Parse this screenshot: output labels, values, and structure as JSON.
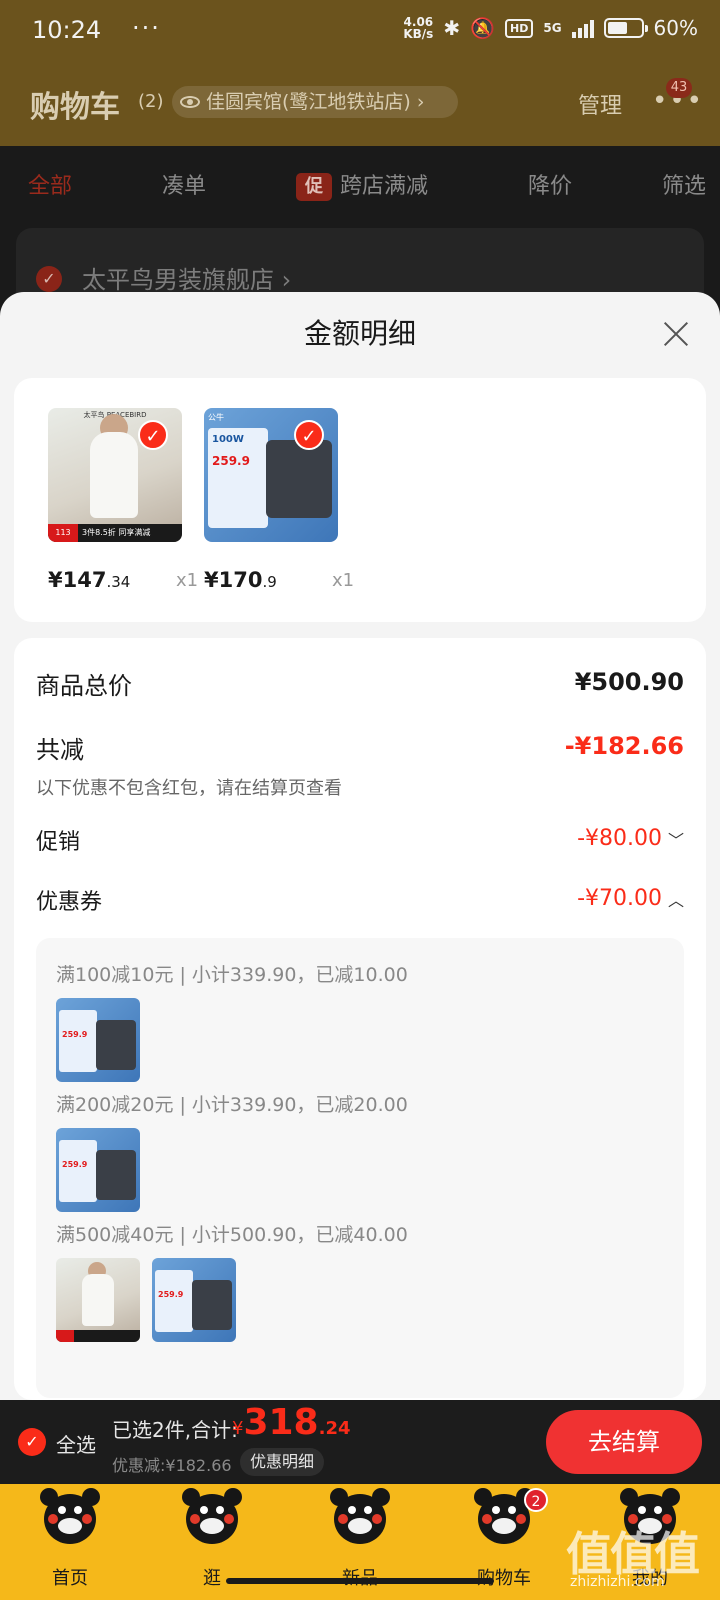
{
  "status_bar": {
    "time": "10:24",
    "dots": "···",
    "net_speed_value": "4.06",
    "net_speed_unit": "KB/s",
    "hd": "HD",
    "network": "5G",
    "battery_percent": "60%",
    "battery_level": 0.6
  },
  "background": {
    "cart_title": "购物车",
    "cart_count": "(2)",
    "store_chip": "佳圆宾馆(鹭江地铁站店)",
    "manage": "管理",
    "more_badge": "43",
    "tabs": [
      "全部",
      "凑单",
      "跨店满减",
      "降价",
      "筛选"
    ],
    "promo_badge": "促",
    "store_name": "太平鸟男装旗舰店",
    "store_chevron": "›"
  },
  "sheet": {
    "title": "金额明细",
    "items": [
      {
        "name": "apparel",
        "price_main": "¥147",
        "price_decimal": ".34",
        "qty": "x1",
        "brand": "太平鸟 PEACEBIRD",
        "tag_price": "113",
        "tag_text": "3件8.5折 同享满减"
      },
      {
        "name": "power-strip",
        "price_main": "¥170",
        "price_decimal": ".9",
        "qty": "x1",
        "brand": "公牛",
        "watt": "100W",
        "panel_price": "259.9"
      }
    ],
    "summary": {
      "total_label": "商品总价",
      "total_value": "¥500.90",
      "reduce_label": "共减",
      "reduce_value": "-¥182.66",
      "hint": "以下优惠不包含红包，请在结算页查看",
      "promo_label": "促销",
      "promo_value": "-¥80.00",
      "promo_chevron": "﹀",
      "coupon_label": "优惠券",
      "coupon_value": "-¥70.00",
      "coupon_chevron": "︿"
    },
    "coupons": [
      {
        "text": "满100减10元 | 小计339.90，已减10.00"
      },
      {
        "text": "满200减20元 | 小计339.90，已减20.00"
      },
      {
        "text": "满500减40元 | 小计500.90，已减40.00"
      }
    ]
  },
  "checkout": {
    "check": "✓",
    "select_all": "全选",
    "selected": "已选2件,合计:",
    "yen": "¥",
    "total_big": "318",
    "total_small": ".24",
    "discount": "优惠减:¥182.66",
    "detail_button": "优惠明细",
    "pay_button": "去结算"
  },
  "nav": {
    "items": [
      "首页",
      "逛",
      "新品",
      "购物车",
      "我的"
    ],
    "cart_badge": "2"
  },
  "watermark": {
    "text": "值值值",
    "url": "zhizhizhi.com"
  },
  "colors": {
    "accent_red": "#fa2c19",
    "nav_yellow": "#f5b81a",
    "header_dim": "#6b531d"
  }
}
